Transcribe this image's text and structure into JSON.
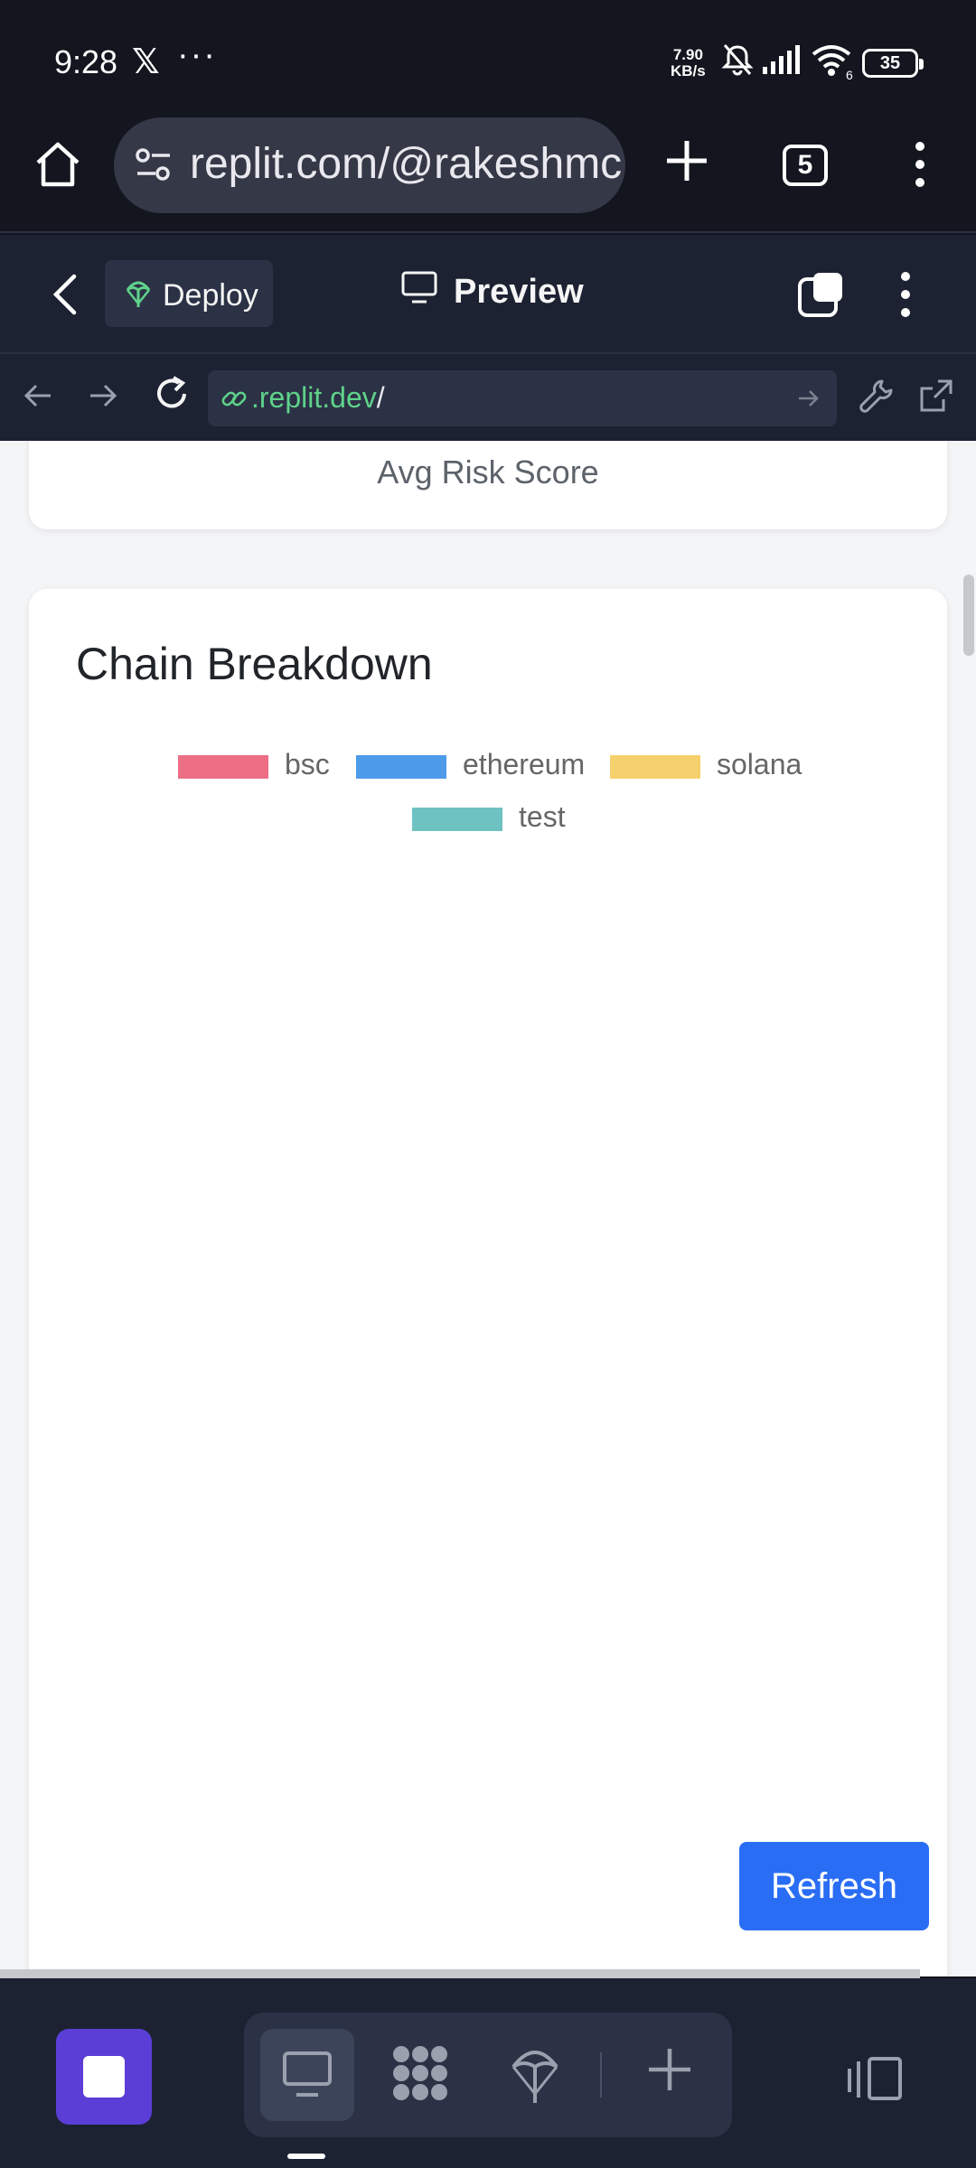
{
  "status_bar": {
    "time": "9:28",
    "x_logo": "𝕏",
    "more": "···",
    "speed_value": "7.90",
    "speed_unit": "KB/s",
    "wifi_badge": "6",
    "battery": "35"
  },
  "browser": {
    "url": "replit.com/@rakeshmc",
    "tab_count": "5"
  },
  "replit_header": {
    "deploy_label": "Deploy",
    "preview_label": "Preview"
  },
  "webview_nav": {
    "address_domain": ".replit.dev",
    "address_path": "/"
  },
  "content": {
    "stat_caption": "Avg Risk Score",
    "chart_title": "Chain Breakdown",
    "refresh_label": "Refresh"
  },
  "chart_data": {
    "type": "pie",
    "title": "Chain Breakdown",
    "legend": [
      {
        "name": "bsc",
        "color": "#ec6f86"
      },
      {
        "name": "ethereum",
        "color": "#4e9bea"
      },
      {
        "name": "solana",
        "color": "#f6d06c"
      },
      {
        "name": "test",
        "color": "#6ec2c2"
      }
    ],
    "legend_placement": "top",
    "values": []
  },
  "colors": {
    "accent_button": "#2a6df5",
    "stop_button": "#5a3ed6",
    "link_green": "#5fd28a"
  },
  "icons": {
    "home": "home-icon",
    "tune": "site-settings-icon",
    "new_tab": "plus-icon",
    "menu": "kebab-menu-icon",
    "back": "chevron-left-icon",
    "deploy": "deploy-icon",
    "preview": "monitor-icon",
    "reload": "reload-icon",
    "devtools": "wrench-icon",
    "open_external": "external-link-icon"
  }
}
